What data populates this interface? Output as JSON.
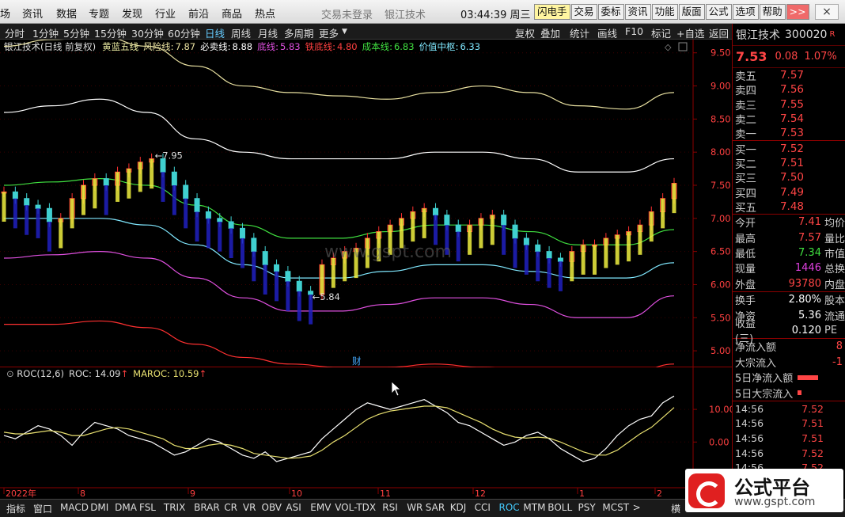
{
  "menu": {
    "items": [
      "场",
      "资讯",
      "数据",
      "专题",
      "发现",
      "行业",
      "前沿",
      "商品",
      "热点"
    ],
    "status": "交易未登录",
    "title": "银江技术",
    "time": "03:44:39",
    "weekday": "周三",
    "buttons": [
      "闪电手",
      "交易",
      "委标",
      "资讯",
      "功能",
      "版面",
      "公式",
      "选项",
      "帮助"
    ],
    "more": ">>"
  },
  "periods": {
    "left": [
      "分时",
      "1分钟",
      "5分钟",
      "15分钟",
      "30分钟",
      "60分钟",
      "日线",
      "周线",
      "月线",
      "多周期",
      "更多"
    ],
    "active": "日线",
    "right": [
      "复权",
      "叠加",
      "统计",
      "画线",
      "F10",
      "标记",
      "+自选",
      "返回"
    ]
  },
  "main": {
    "name": "银江技术(日线 前复权)",
    "indicator": "黄蓝五线",
    "lines": [
      {
        "label": "风险线",
        "value": "7.87",
        "color": "#e8e0a0"
      },
      {
        "label": "必卖线",
        "value": "8.88",
        "color": "#ffffff"
      },
      {
        "label": "底线",
        "value": "5.83",
        "color": "#e050e0"
      },
      {
        "label": "铁底线",
        "value": "4.80",
        "color": "#ff4040"
      },
      {
        "label": "成本线",
        "value": "6.83",
        "color": "#40e040"
      },
      {
        "label": "价值中枢",
        "value": "6.33",
        "color": "#80e8ff"
      }
    ],
    "marks": {
      "high": "7.95",
      "low": "5.84"
    },
    "cai": "财",
    "watermark": "www.gspt.com"
  },
  "roc": {
    "name": "ROC(12,6)",
    "roc_label": "ROC",
    "roc_value": "14.09",
    "ma_label": "MAROC",
    "ma_value": "10.59"
  },
  "xaxis": [
    "2022年",
    "8",
    "9",
    "10",
    "11",
    "12",
    "1",
    "2"
  ],
  "chart_data": {
    "type": "candlestick",
    "series": [
      {
        "name": "风险线",
        "values": [
          9.6,
          9.7,
          9.75,
          9.6,
          9.3,
          9.0,
          8.9,
          8.85,
          8.8,
          8.9,
          9.0,
          8.9,
          8.7,
          8.65,
          8.9
        ]
      },
      {
        "name": "必卖线",
        "values": [
          8.6,
          8.7,
          8.8,
          8.6,
          8.2,
          8.0,
          7.9,
          7.9,
          7.9,
          8.0,
          8.0,
          7.9,
          7.7,
          7.7,
          7.9
        ]
      },
      {
        "name": "成本线",
        "values": [
          7.5,
          7.55,
          7.6,
          7.5,
          7.2,
          6.9,
          6.7,
          6.7,
          6.8,
          6.9,
          6.9,
          6.8,
          6.6,
          6.6,
          6.83
        ]
      },
      {
        "name": "价值中枢",
        "values": [
          7.0,
          7.0,
          7.0,
          6.9,
          6.6,
          6.3,
          6.1,
          6.1,
          6.2,
          6.3,
          6.3,
          6.2,
          6.1,
          6.1,
          6.33
        ]
      },
      {
        "name": "底线",
        "values": [
          6.4,
          6.45,
          6.5,
          6.4,
          6.1,
          5.8,
          5.6,
          5.6,
          5.7,
          5.8,
          5.8,
          5.7,
          5.5,
          5.5,
          5.83
        ]
      },
      {
        "name": "铁底线",
        "values": [
          5.4,
          5.4,
          5.45,
          5.35,
          5.1,
          4.9,
          4.8,
          4.75,
          4.75,
          4.8,
          4.75,
          4.7,
          4.6,
          4.6,
          4.8
        ]
      }
    ],
    "closes": [
      7.4,
      7.3,
      7.2,
      7.15,
      6.95,
      7.0,
      7.3,
      7.5,
      7.6,
      7.5,
      7.7,
      7.75,
      7.85,
      7.9,
      7.7,
      7.5,
      7.3,
      7.1,
      7.0,
      6.95,
      6.85,
      6.7,
      6.5,
      6.3,
      6.2,
      6.05,
      5.9,
      5.85,
      6.3,
      6.4,
      6.5,
      6.55,
      6.7,
      6.8,
      6.9,
      7.0,
      7.1,
      7.15,
      7.05,
      6.9,
      6.8,
      6.9,
      7.0,
      7.05,
      6.9,
      6.7,
      6.6,
      6.5,
      6.4,
      6.35,
      6.5,
      6.6,
      6.6,
      6.7,
      6.75,
      6.8,
      6.9,
      7.1,
      7.3,
      7.53
    ],
    "yticks": [
      9.5,
      9.0,
      8.5,
      8.0,
      7.5,
      7.0,
      6.5,
      6.0,
      5.5,
      5.0
    ],
    "ylim": [
      4.75,
      9.7
    ],
    "roc": [
      2,
      1,
      3,
      5,
      4,
      2,
      -1,
      3,
      6,
      5,
      4,
      2,
      1,
      0,
      -2,
      -4,
      -3,
      -1,
      1,
      0,
      -2,
      -4,
      -5,
      -3,
      -6,
      -5,
      -4,
      -3,
      1,
      4,
      7,
      10,
      12,
      11,
      10,
      11,
      12,
      13,
      11,
      9,
      6,
      5,
      3,
      1,
      -1,
      0,
      2,
      3,
      1,
      -2,
      -4,
      -6,
      -5,
      -2,
      2,
      5,
      7,
      8,
      12,
      14.09
    ],
    "maroc": [
      3,
      2.5,
      2.5,
      3,
      3.5,
      3,
      2,
      2,
      3,
      4,
      4.5,
      4,
      3,
      2,
      1,
      -1,
      -2,
      -2,
      -1,
      -0.5,
      -1,
      -2,
      -3.5,
      -4,
      -4.5,
      -5,
      -4.8,
      -4.3,
      -2.5,
      0,
      2,
      4.5,
      7,
      8.5,
      9.5,
      10,
      10.5,
      11,
      11,
      10.5,
      9,
      7.5,
      6,
      4,
      2.5,
      1.5,
      1.2,
      1.5,
      1.2,
      0,
      -1.5,
      -3,
      -4,
      -4,
      -2.5,
      0,
      2.5,
      4.5,
      7.5,
      10.59
    ],
    "roc_yticks": [
      10.0,
      0.0
    ],
    "roc_ylim": [
      -14,
      19
    ]
  },
  "panel": {
    "name": "银江技术",
    "code": "300020",
    "r": "R",
    "price": "7.53",
    "change": "0.08",
    "pct": "1.07%",
    "sells": [
      {
        "label": "卖五",
        "price": "7.57"
      },
      {
        "label": "卖四",
        "price": "7.56"
      },
      {
        "label": "卖三",
        "price": "7.55"
      },
      {
        "label": "卖二",
        "price": "7.54"
      },
      {
        "label": "卖一",
        "price": "7.53"
      }
    ],
    "buys": [
      {
        "label": "买一",
        "price": "7.52"
      },
      {
        "label": "买二",
        "price": "7.51"
      },
      {
        "label": "买三",
        "price": "7.50"
      },
      {
        "label": "买四",
        "price": "7.49"
      },
      {
        "label": "买五",
        "price": "7.48"
      }
    ],
    "stats": [
      {
        "label": "今开",
        "value": "7.41",
        "color": "#ff4545",
        "extra": "均价"
      },
      {
        "label": "最高",
        "value": "7.57",
        "color": "#ff4545",
        "extra": "量比"
      },
      {
        "label": "最低",
        "value": "7.34",
        "color": "#40e040",
        "extra": "市值"
      },
      {
        "label": "现量",
        "value": "1446",
        "color": "#e040e0",
        "extra": "总换"
      },
      {
        "label": "外盘",
        "value": "93780",
        "color": "#ff4545",
        "extra": "内盘"
      }
    ],
    "stats2": [
      {
        "label": "换手",
        "value": "2.80%",
        "color": "#ffffff",
        "extra": "股本"
      },
      {
        "label": "净资",
        "value": "5.36",
        "color": "#ffffff",
        "extra": "流通"
      },
      {
        "label": "收益(三)",
        "value": "0.120",
        "color": "#ffffff",
        "extra": "PE"
      }
    ],
    "flows": [
      {
        "label": "净流入额",
        "value": "8"
      },
      {
        "label": "大宗流入",
        "value": "-1"
      },
      {
        "label": "5日净流入额",
        "value": ""
      },
      {
        "label": "5日大宗流入",
        "value": ""
      }
    ],
    "ticks": [
      {
        "time": "14:56",
        "price": "7.52"
      },
      {
        "time": "14:56",
        "price": "7.51"
      },
      {
        "time": "14:56",
        "price": "7.51"
      },
      {
        "time": "14:56",
        "price": "7.52"
      },
      {
        "time": "14:56",
        "price": "7.52"
      }
    ]
  },
  "bottom": {
    "tabs": [
      "指标",
      "窗口",
      "MACD",
      "DMI",
      "DMA",
      "FSL",
      "TRIX",
      "BRAR",
      "CR",
      "VR",
      "OBV",
      "ASI",
      "EMV",
      "VOL-TDX",
      "RSI",
      "WR",
      "SAR",
      "KDJ",
      "CCI",
      "ROC",
      "MTM",
      "BOLL",
      "PSY",
      "MCST",
      ">"
    ],
    "active": "ROC",
    "extra": "横"
  },
  "logo": {
    "title": "公式平台",
    "url": "www.gspt.com"
  }
}
